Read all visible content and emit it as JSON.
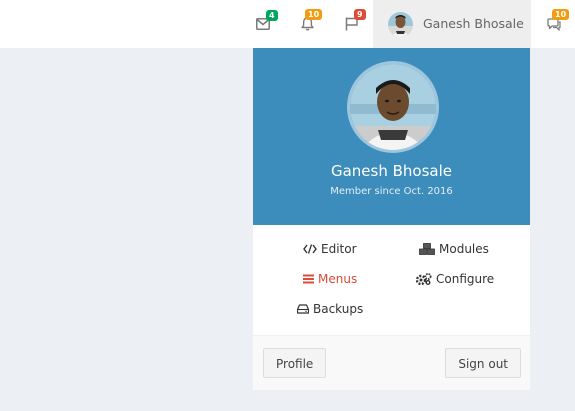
{
  "navbar": {
    "messages": {
      "icon": "envelope-icon",
      "badge": "4",
      "badge_color": "#00a65a"
    },
    "notifications": {
      "icon": "bell-icon",
      "badge": "10",
      "badge_color": "#f39c12"
    },
    "tasks": {
      "icon": "flag-icon",
      "badge": "9",
      "badge_color": "#dd4b39"
    },
    "user_name": "Ganesh Bhosale",
    "comments": {
      "icon": "comments-icon",
      "badge": "10",
      "badge_color": "#f39c12"
    }
  },
  "user_dropdown": {
    "header": {
      "name": "Ganesh Bhosale",
      "member_since": "Member since Oct. 2016",
      "background_color": "#3c8dbc"
    },
    "links": [
      {
        "label": "Editor",
        "icon": "code-icon"
      },
      {
        "label": "Modules",
        "icon": "cubes-icon"
      },
      {
        "label": "Menus",
        "icon": "bars-icon",
        "active": true,
        "color": "#dd4b39"
      },
      {
        "label": "Configure",
        "icon": "cogs-icon"
      },
      {
        "label": "Backups",
        "icon": "hdd-icon"
      }
    ],
    "footer": {
      "profile_label": "Profile",
      "signout_label": "Sign out"
    }
  }
}
